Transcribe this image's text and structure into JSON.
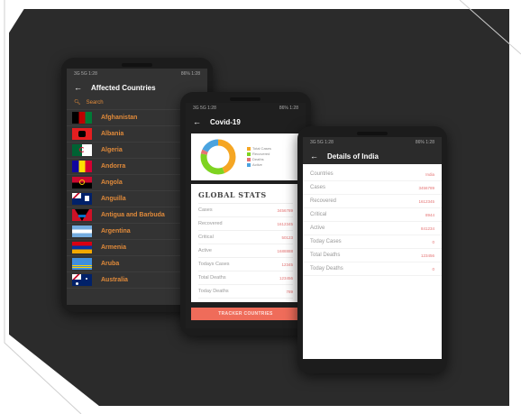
{
  "phone1": {
    "status_left": "3G 5G 1:28",
    "status_right": "86% 1:28",
    "title": "Affected Countries",
    "search_placeholder": "Search",
    "countries": [
      "Afghanistan",
      "Albania",
      "Algeria",
      "Andorra",
      "Angola",
      "Anguilla",
      "Antigua and Barbuda",
      "Argentina",
      "Armenia",
      "Aruba",
      "Australia"
    ]
  },
  "phone2": {
    "status_left": "3G 5G 1:28",
    "status_right": "86% 1:28",
    "title": "Covid-19",
    "legend": [
      {
        "label": "Total Cases",
        "color": "#f5a623"
      },
      {
        "label": "Recovered",
        "color": "#7ed321"
      },
      {
        "label": "Deaths",
        "color": "#e57373"
      },
      {
        "label": "Active",
        "color": "#4aa3df"
      }
    ],
    "pie_fractions": [
      0.44,
      0.34,
      0.04,
      0.18
    ],
    "stats_title": "GLOBAL STATS",
    "stats": [
      {
        "label": "Cases",
        "value": "3456789"
      },
      {
        "label": "Recovered",
        "value": "1612345"
      },
      {
        "label": "Critical",
        "value": "50123"
      },
      {
        "label": "Active",
        "value": "1688888"
      },
      {
        "label": "Todays Cases",
        "value": "12345"
      },
      {
        "label": "Total Deaths",
        "value": "123456"
      },
      {
        "label": "Today Deaths",
        "value": "789"
      }
    ],
    "button_label": "TRACKER COUNTRIES"
  },
  "phone3": {
    "status_left": "3G 5G 1:28",
    "status_right": "86% 1:28",
    "title": "Details of India",
    "details": [
      {
        "label": "Countries",
        "value": "India"
      },
      {
        "label": "Cases",
        "value": "3456789"
      },
      {
        "label": "Recovered",
        "value": "1612345"
      },
      {
        "label": "Critical",
        "value": "8944"
      },
      {
        "label": "Active",
        "value": "841234"
      },
      {
        "label": "Today Cases",
        "value": "0"
      },
      {
        "label": "Total Deaths",
        "value": "123456"
      },
      {
        "label": "Today Deaths",
        "value": "0"
      }
    ]
  }
}
